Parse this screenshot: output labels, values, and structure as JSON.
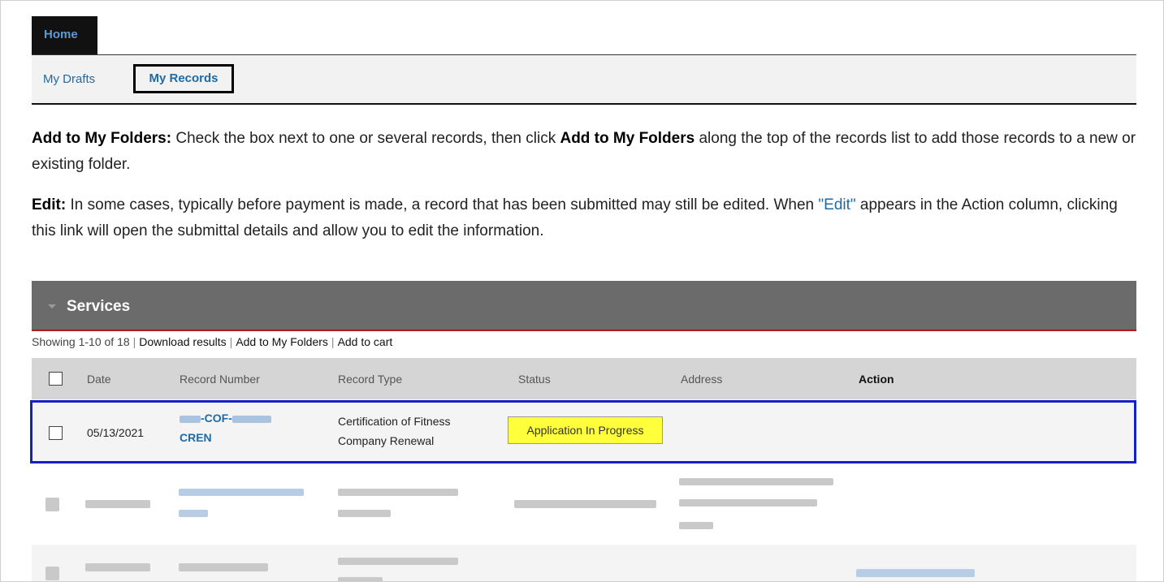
{
  "nav": {
    "home_tab": "Home",
    "drafts": "My Drafts",
    "records": "My Records"
  },
  "help": {
    "p1_label": "Add to My Folders:",
    "p1_text_a": " Check the box next to one or several records, then click ",
    "p1_bold": "Add to My Folders",
    "p1_text_b": " along the top of the records list to add those records to a new or existing folder.",
    "p2_label": "Edit:",
    "p2_text_a": " In some cases, typically before payment is made, a record that has been submitted may still be edited. When ",
    "p2_link": "\"Edit\"",
    "p2_text_b": " appears in the Action column, clicking this link will open the submittal details and allow you to edit the information."
  },
  "services": {
    "title": "Services",
    "showing": "Showing 1-10 of 18",
    "download": "Download results",
    "add_folders": "Add to My Folders",
    "add_cart": "Add to cart"
  },
  "table": {
    "columns": [
      "Date",
      "Record Number",
      "Record Type",
      "Status",
      "Address",
      "Action"
    ],
    "row1": {
      "date": "05/13/2021",
      "record_mid": "-COF-",
      "record_end": "CREN",
      "type_line1": "Certification of Fitness",
      "type_line2": "Company Renewal",
      "status": "Application In Progress"
    }
  }
}
